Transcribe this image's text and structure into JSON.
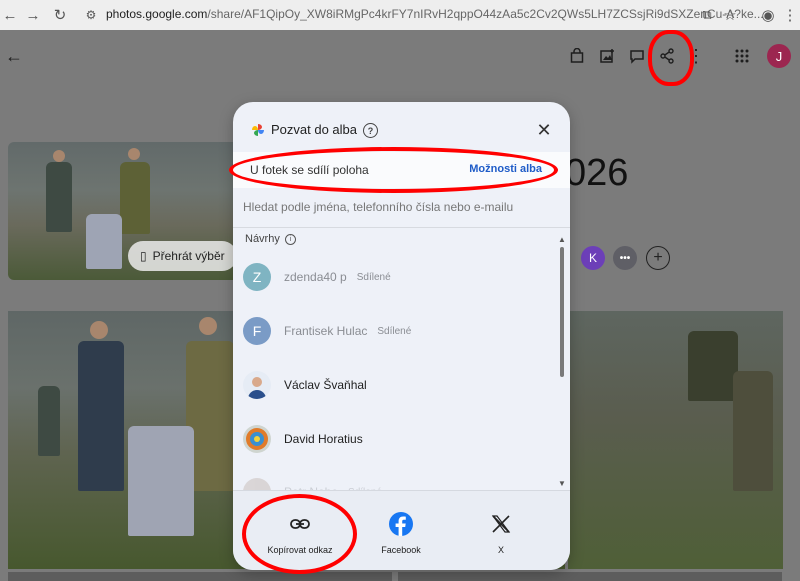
{
  "browser": {
    "url_host": "photos.google.com",
    "url_path": "/share/AF1QipOy_XW8iRMgPc4krFY7nIRvH2qppO44zAa5c2Cv2QWs5LH7ZCSsjRi9dSXZenCu-A?ke..."
  },
  "page": {
    "user_initial": "J",
    "play_label": "Přehrát výběr",
    "title_fragment": "026",
    "shared_avatar_initial": "K",
    "more_label": "•••",
    "add_label": "+"
  },
  "dialog": {
    "title": "Pozvat do alba",
    "location_notice": "U fotek se sdílí poloha",
    "album_options_link": "Možnosti alba",
    "search_placeholder": "Hledat podle jména, telefonního čísla nebo e-mailu",
    "suggestions_heading": "Návrhy",
    "contacts": [
      {
        "initial": "Z",
        "name": "zdenda40 p",
        "tag": "Sdílené",
        "color": "#2e8aa1"
      },
      {
        "initial": "F",
        "name": "Frantisek Hulac",
        "tag": "Sdílené",
        "color": "#1f6fb2"
      },
      {
        "initial": "",
        "name": "Václav Švaňhal",
        "tag": "",
        "color": "#c9d6ea"
      },
      {
        "initial": "",
        "name": "David Horatius",
        "tag": "",
        "color": "#d9a13a"
      },
      {
        "initial": "",
        "name": "Petr Nohe",
        "tag": "Sdílené",
        "color": "#b4a39a"
      }
    ],
    "share_options": [
      {
        "label": "Kopírovat odkaz",
        "icon": "link-icon"
      },
      {
        "label": "Facebook",
        "icon": "facebook-icon"
      },
      {
        "label": "X",
        "icon": "x-logo-icon"
      }
    ]
  },
  "colors": {
    "annotation": "#ff0000",
    "link": "#1f5cc8",
    "facebook": "#1877f2"
  }
}
